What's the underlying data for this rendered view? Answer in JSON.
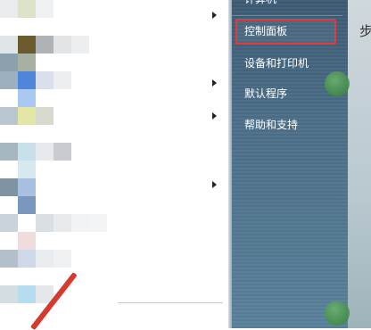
{
  "start_menu": {
    "right_items": [
      {
        "label": "计算机"
      },
      {
        "label": "控制面板"
      },
      {
        "label": "设备和打印机"
      },
      {
        "label": "默认程序"
      },
      {
        "label": "帮助和支持"
      }
    ],
    "highlighted_item": "控制面板"
  },
  "colors": {
    "highlight_border": "#e23b3b",
    "panel_blue": "#4a6d86",
    "annotation_red": "#d63a2e"
  },
  "desktop": {
    "edge_glyph": "步"
  }
}
